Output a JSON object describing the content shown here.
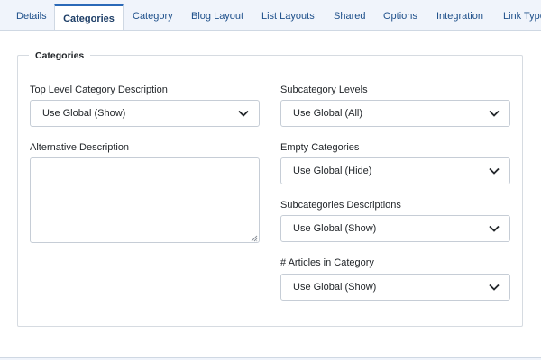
{
  "tabs": [
    {
      "label": "Details",
      "active": false
    },
    {
      "label": "Categories",
      "active": true
    },
    {
      "label": "Category",
      "active": false
    },
    {
      "label": "Blog Layout",
      "active": false
    },
    {
      "label": "List Layouts",
      "active": false
    },
    {
      "label": "Shared",
      "active": false
    },
    {
      "label": "Options",
      "active": false
    },
    {
      "label": "Integration",
      "active": false
    },
    {
      "label": "Link Type",
      "active": false
    }
  ],
  "fieldset": {
    "legend": "Categories",
    "top_level_description": {
      "label": "Top Level Category Description",
      "value": "Use Global (Show)"
    },
    "alternative_description": {
      "label": "Alternative Description",
      "value": ""
    },
    "subcategory_levels": {
      "label": "Subcategory Levels",
      "value": "Use Global (All)"
    },
    "empty_categories": {
      "label": "Empty Categories",
      "value": "Use Global (Hide)"
    },
    "subcategories_descriptions": {
      "label": "Subcategories Descriptions",
      "value": "Use Global (Show)"
    },
    "articles_in_category": {
      "label": "# Articles in Category",
      "value": "Use Global (Show)"
    }
  },
  "colors": {
    "accent": "#2a69b8",
    "tab_text": "#1d4f8a",
    "background": "#f0f4fb",
    "border": "#c6cdd6"
  },
  "icons": {
    "select_caret": "chevron-down-icon",
    "textarea_resize": "resize-grip-icon"
  }
}
